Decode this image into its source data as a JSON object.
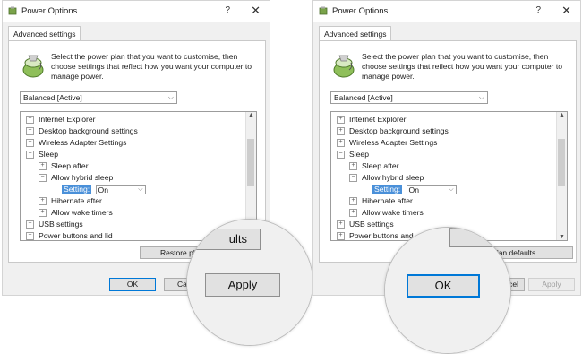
{
  "windows": [
    {
      "title": "Power Options",
      "help_glyph": "?",
      "close_glyph": "✕",
      "tab_label": "Advanced settings",
      "description": "Select the power plan that you want to customise, then choose settings that reflect how you want your computer to manage power.",
      "plan_select": "Balanced [Active]",
      "tree": {
        "internet_explorer": "Internet Explorer",
        "desktop_bg": "Desktop background settings",
        "wireless": "Wireless Adapter Settings",
        "sleep": "Sleep",
        "sleep_after": "Sleep after",
        "hybrid_sleep": "Allow hybrid sleep",
        "setting_label": "Setting:",
        "setting_value": "On",
        "hibernate": "Hibernate after",
        "wake_timers": "Allow wake timers",
        "usb": "USB settings",
        "power_buttons": "Power buttons and lid"
      },
      "restore_label": "Restore pl",
      "ok_label": "OK",
      "cancel_label": "Ca",
      "zoom": {
        "top_text": "ults",
        "button": "Apply"
      }
    },
    {
      "title": "Power Options",
      "help_glyph": "?",
      "close_glyph": "✕",
      "tab_label": "Advanced settings",
      "description": "Select the power plan that you want to customise, then choose settings that reflect how you want your computer to manage power.",
      "plan_select": "Balanced [Active]",
      "tree": {
        "internet_explorer": "Internet Explorer",
        "desktop_bg": "Desktop background settings",
        "wireless": "Wireless Adapter Settings",
        "sleep": "Sleep",
        "sleep_after": "Sleep after",
        "hybrid_sleep": "Allow hybrid sleep",
        "setting_label": "Setting:",
        "setting_value": "On",
        "hibernate": "Hibernate after",
        "wake_timers": "Allow wake timers",
        "usb": "USB settings",
        "power_buttons": "Power buttons and"
      },
      "restore_label": "e plan defaults",
      "cancel_label": "ncel",
      "apply_label": "Apply",
      "zoom": {
        "button": "OK"
      }
    }
  ],
  "colors": {
    "accent": "#0078d7",
    "setting_highlight": "#4a90d9"
  },
  "icons": {
    "plan": "power-plan-icon",
    "expand": "plus-box-icon",
    "collapse": "minus-box-icon"
  }
}
